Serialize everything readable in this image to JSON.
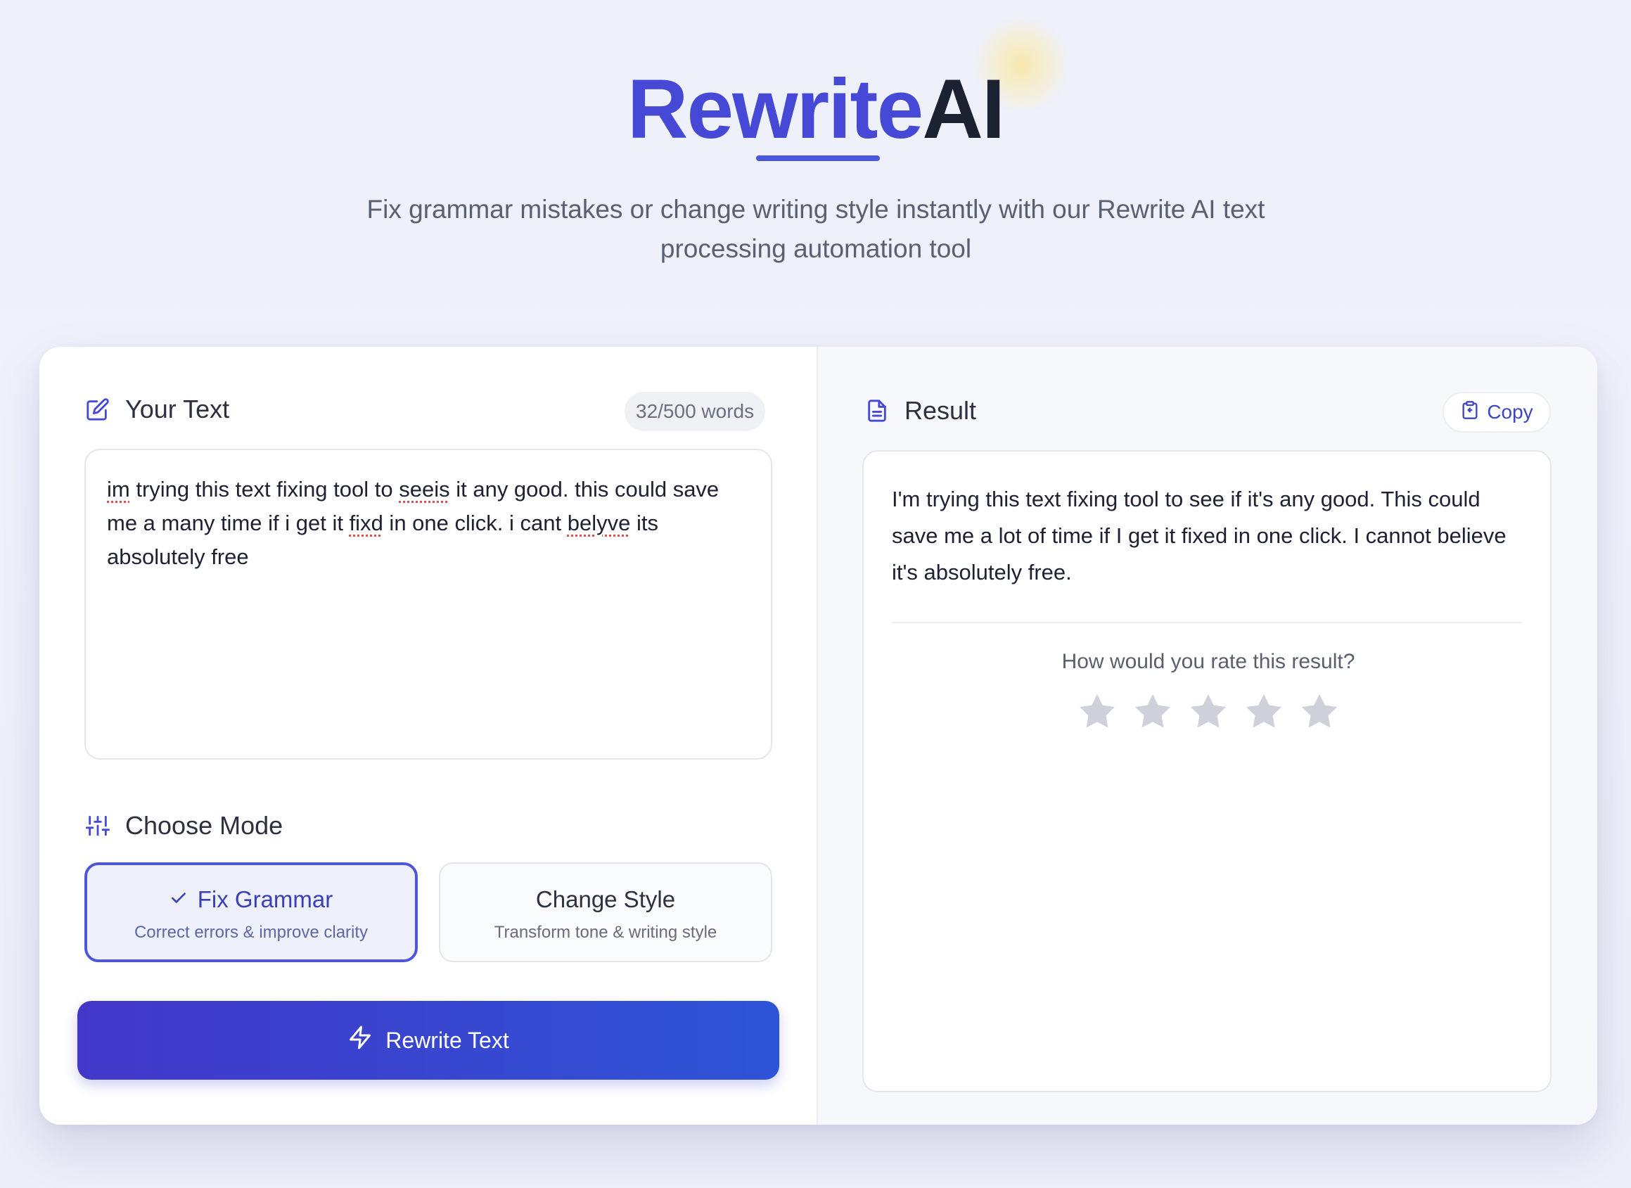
{
  "header": {
    "brand_part1": "Rewrite",
    "brand_part2": "AI",
    "subtitle_line1": "Fix grammar mistakes or change writing style instantly with our Rewrite AI text",
    "subtitle_line2": "processing automation tool"
  },
  "input_panel": {
    "title": "Your Text",
    "word_count": "32/500 words",
    "text_segments": [
      "im",
      " trying this text fixing tool to ",
      "seeis",
      " it any good. this could save me a many time if i get it ",
      "fixd",
      " in one click. i cant ",
      "belyve",
      " its absolutely free"
    ],
    "mode_title": "Choose Mode",
    "modes": [
      {
        "label": "Fix Grammar",
        "description": "Correct errors & improve clarity",
        "selected": true
      },
      {
        "label": "Change Style",
        "description": "Transform tone & writing style",
        "selected": false
      }
    ],
    "submit_label": "Rewrite Text"
  },
  "result_panel": {
    "title": "Result",
    "copy_label": "Copy",
    "text": "I'm trying this text fixing tool to see if it's any good. This could save me a lot of time if I get it fixed in one click. I cannot believe it's absolutely free.",
    "rating_prompt": "How would you rate this result?",
    "rating_max": 5,
    "rating_value": 0
  },
  "colors": {
    "accent": "#4549d6",
    "button_gradient_start": "#4337c9",
    "button_gradient_end": "#2d54d6",
    "star_inactive": "#cfd1da"
  },
  "icons": {
    "your_text": "edit-icon",
    "choose_mode": "sliders-icon",
    "selected_mode": "check-icon",
    "rewrite": "bolt-icon",
    "result": "document-icon",
    "copy": "clipboard-icon",
    "rating": "star-icon"
  }
}
